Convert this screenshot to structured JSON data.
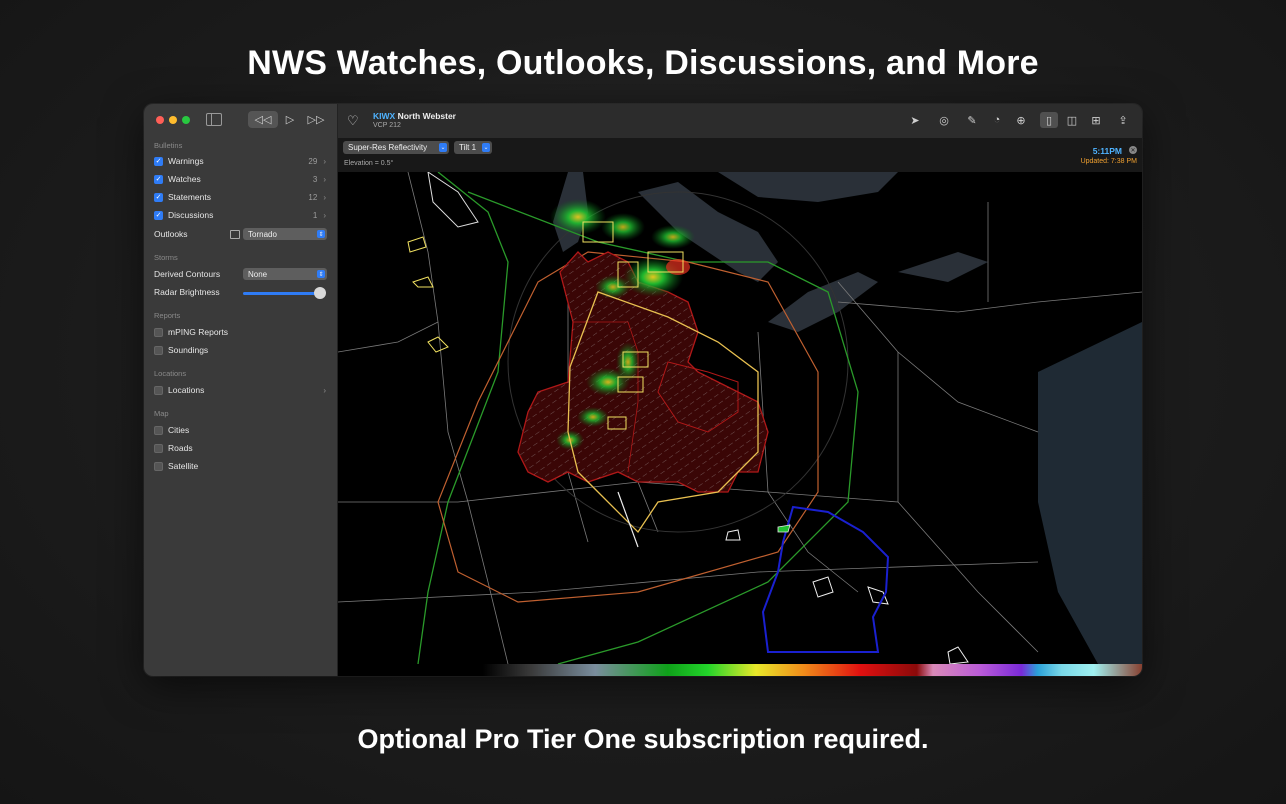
{
  "headline": "NWS Watches, Outlooks, Discussions, and More",
  "footline": "Optional Pro Tier One subscription required.",
  "toolbar": {
    "station_id": "KIWX",
    "station_name": "North Webster",
    "vcp": "VCP 212",
    "icons": [
      "heart-icon",
      "location-arrow-icon",
      "radar-target-icon",
      "pencil-icon",
      "timer-icon",
      "crosshair-icon",
      "single-pane-icon",
      "split-pane-icon",
      "quad-pane-icon",
      "share-icon"
    ]
  },
  "map": {
    "product": "Super-Res Reflectivity",
    "tilt": "Tilt 1",
    "elevation": "Elevation = 0.5°",
    "time": "5:11PM",
    "updated": "Updated: 7:38 PM"
  },
  "sidebar": {
    "bulletins_header": "Bulletins",
    "bulletins": [
      {
        "label": "Warnings",
        "count": "29",
        "checked": true
      },
      {
        "label": "Watches",
        "count": "3",
        "checked": true
      },
      {
        "label": "Statements",
        "count": "12",
        "checked": true
      },
      {
        "label": "Discussions",
        "count": "1",
        "checked": true
      }
    ],
    "outlooks_label": "Outlooks",
    "outlooks_value": "Tornado",
    "storms_header": "Storms",
    "derived_contours_label": "Derived Contours",
    "derived_contours_value": "None",
    "radar_brightness_label": "Radar Brightness",
    "reports_header": "Reports",
    "mping_label": "mPING Reports",
    "soundings_label": "Soundings",
    "locations_header": "Locations",
    "locations_label": "Locations",
    "map_header": "Map",
    "cities_label": "Cities",
    "roads_label": "Roads",
    "satellite_label": "Satellite"
  },
  "colors": {
    "accent": "#2f7cf6",
    "time": "#4fb3ff",
    "updated": "#f0a030",
    "warning_polygon": "#b01818",
    "watch_outline": "#e8c050",
    "outlook_green": "#2a9a2a",
    "outlook_orange": "#c06030",
    "watch_blue": "#1a20d0"
  }
}
